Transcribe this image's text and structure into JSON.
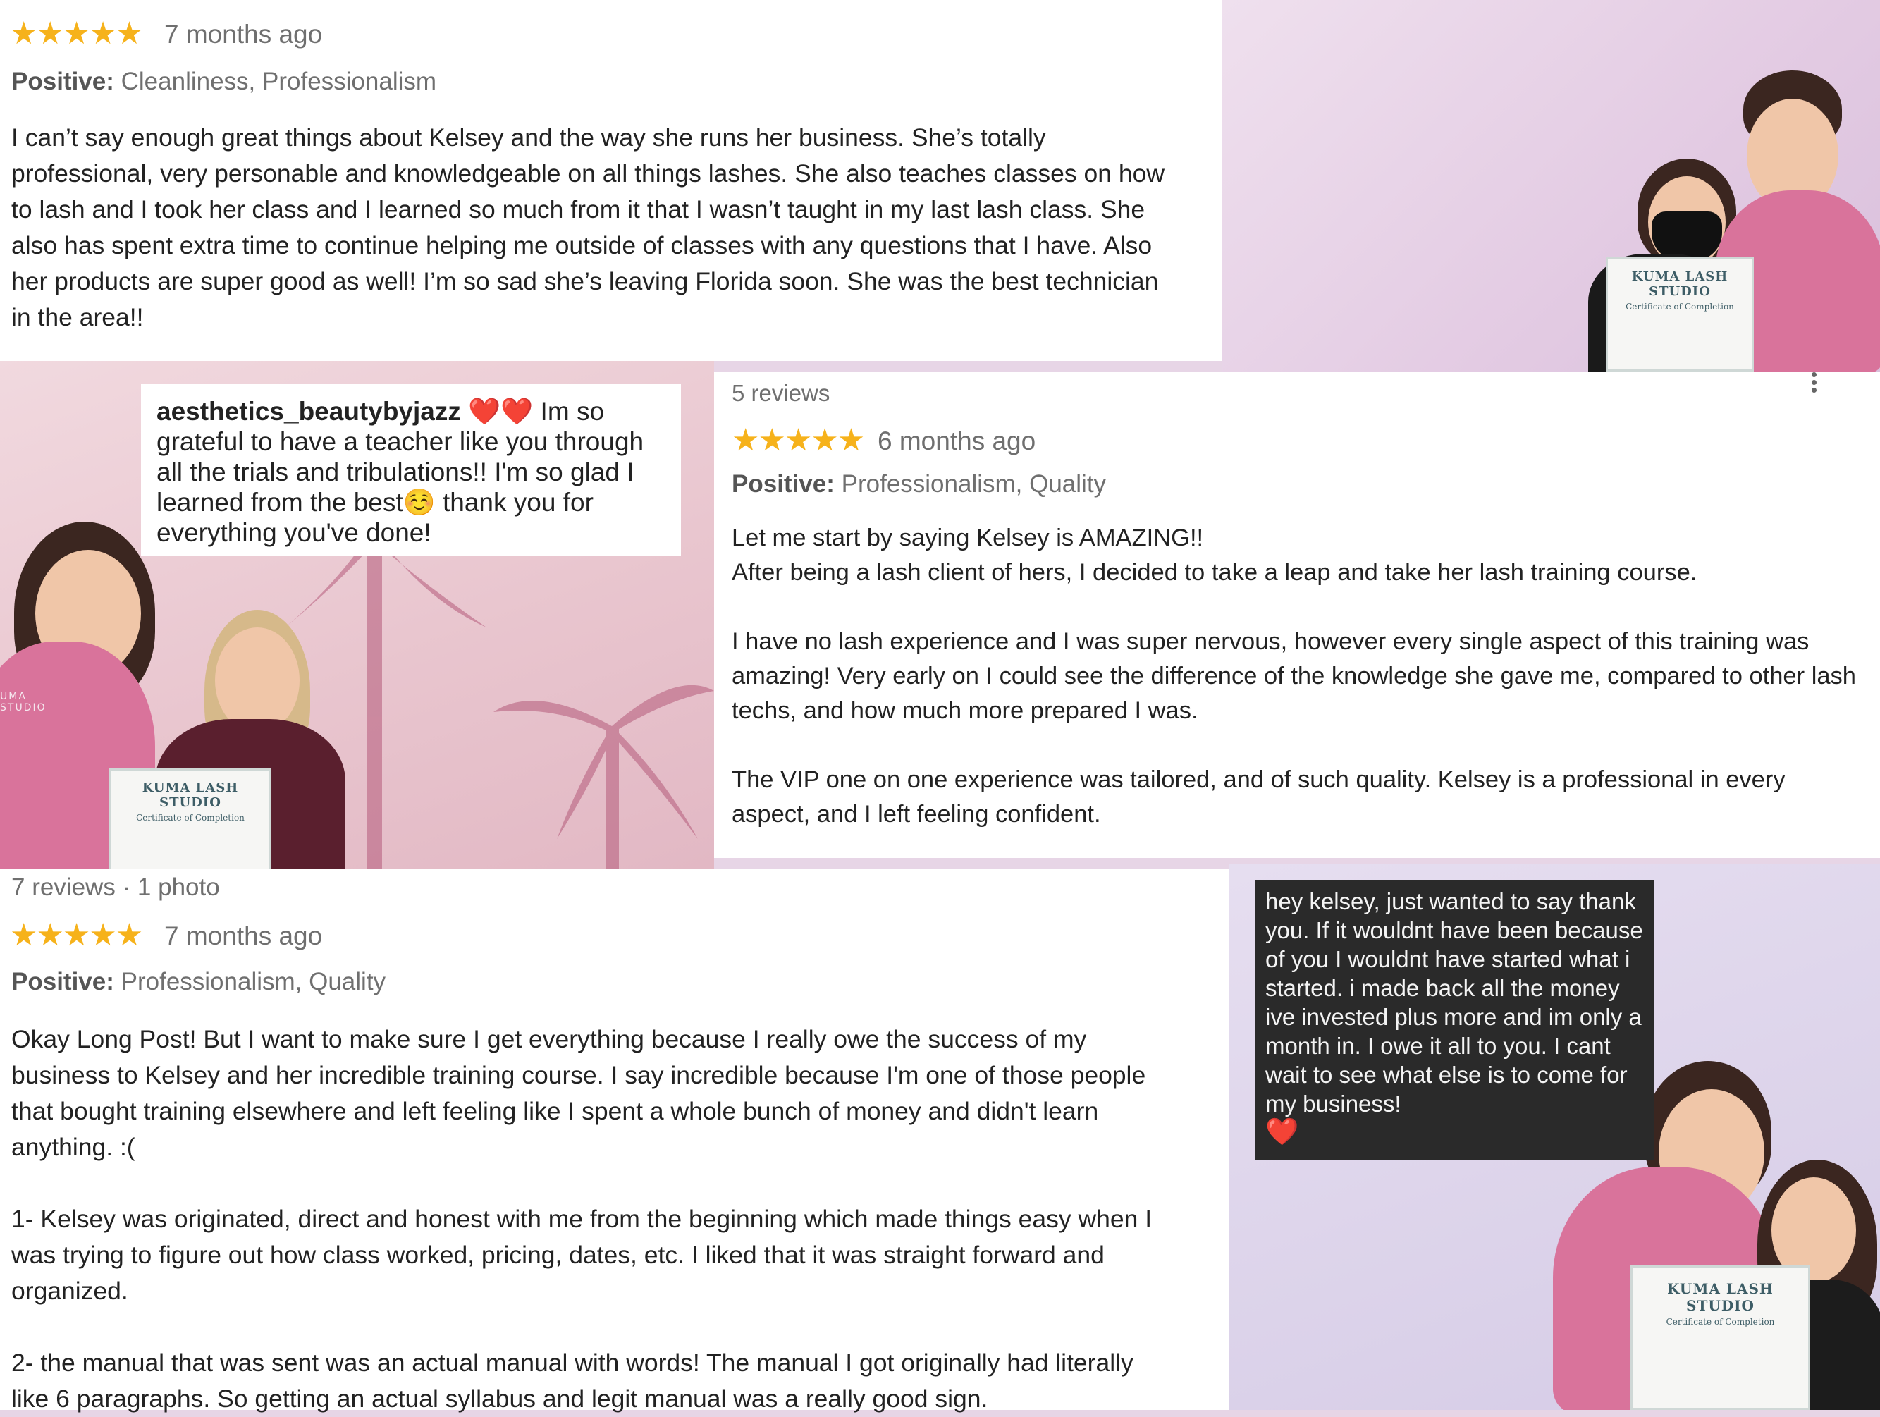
{
  "review1": {
    "stars": "★★★★★",
    "time": "7 months ago",
    "positive_label": "Positive:",
    "positive_values": "Cleanliness, Professionalism",
    "text": "I can’t say enough great things about Kelsey and the way she runs her business. She’s totally\nprofessional, very personable and knowledgeable on all things lashes. She also teaches classes on how\nto lash and I took her class and I learned so much from it that I wasn’t taught in my last lash class. She\nalso has spent extra time to continue helping me outside of classes with any questions that I have. Also\nher products are super good as well! I’m so sad she’s leaving Florida soon. She was the best technician\nin the area!!"
  },
  "review2": {
    "reviewer_meta": "5 reviews",
    "stars": "★★★★★",
    "time": "6 months ago",
    "positive_label": "Positive:",
    "positive_values": "Professionalism, Quality",
    "text": "Let me start by saying Kelsey is AMAZING!!\nAfter being a lash client of hers, I decided to take a leap and take her lash training course.\n\nI have no lash experience and I was super nervous, however every single aspect of this training was\namazing! Very early on I could see the difference of the knowledge she gave me, compared to other lash\ntechs, and how much more prepared I was.\n\nThe VIP one on one experience was tailored, and of such quality. Kelsey is a professional in every\naspect, and I left feeling confident."
  },
  "review3": {
    "reviewer_meta": "7 reviews · 1 photo",
    "stars": "★★★★★",
    "time": "7 months ago",
    "positive_label": "Positive:",
    "positive_values": "Professionalism, Quality",
    "text": "Okay Long Post! But I want to make sure I get everything because I really owe the success of my\nbusiness to Kelsey and her incredible training course. I say incredible because I'm one of those people\nthat bought training elsewhere and left feeling like I spent a whole bunch of money and didn't learn\nanything. :(\n\n1- Kelsey was originated, direct and honest with me from the beginning which made things easy when I\nwas trying to figure out how class worked, pricing, dates, etc. I liked that it was straight forward and\norganized.\n\n2- the manual that was sent was an actual manual with words! The manual I got originally had literally\nlike 6 paragraphs. So getting an actual syllabus and legit manual was a really good sign."
  },
  "ig_comment": {
    "username": "aesthetics_beautybyjazz",
    "emoji_hearts": "❤️❤️",
    "text_part1": " Im so grateful to have a teacher like you through all the trials and tribulations!! I'm so glad I learned from the best",
    "emoji_smile": "☺️",
    "text_part2": " thank you for everything you've done!"
  },
  "dm_message": {
    "text": "hey kelsey, just wanted to say thank you. If it wouldnt have been because of you I wouldnt have started what i started. i made back all the money ive invested plus more and im only a month in. I owe it all to you. I cant wait to see what else is to come for my business!",
    "emoji_heart": "❤️"
  },
  "certificates": {
    "title": "KUMA LASH STUDIO",
    "subtitle": "Certificate of Completion"
  },
  "scrubs_text": "UMA\nSTUDIO",
  "colors": {
    "star": "#f6b21b",
    "scrubs_pink": "#d9739b",
    "dm_bg": "#2a2a2a"
  }
}
